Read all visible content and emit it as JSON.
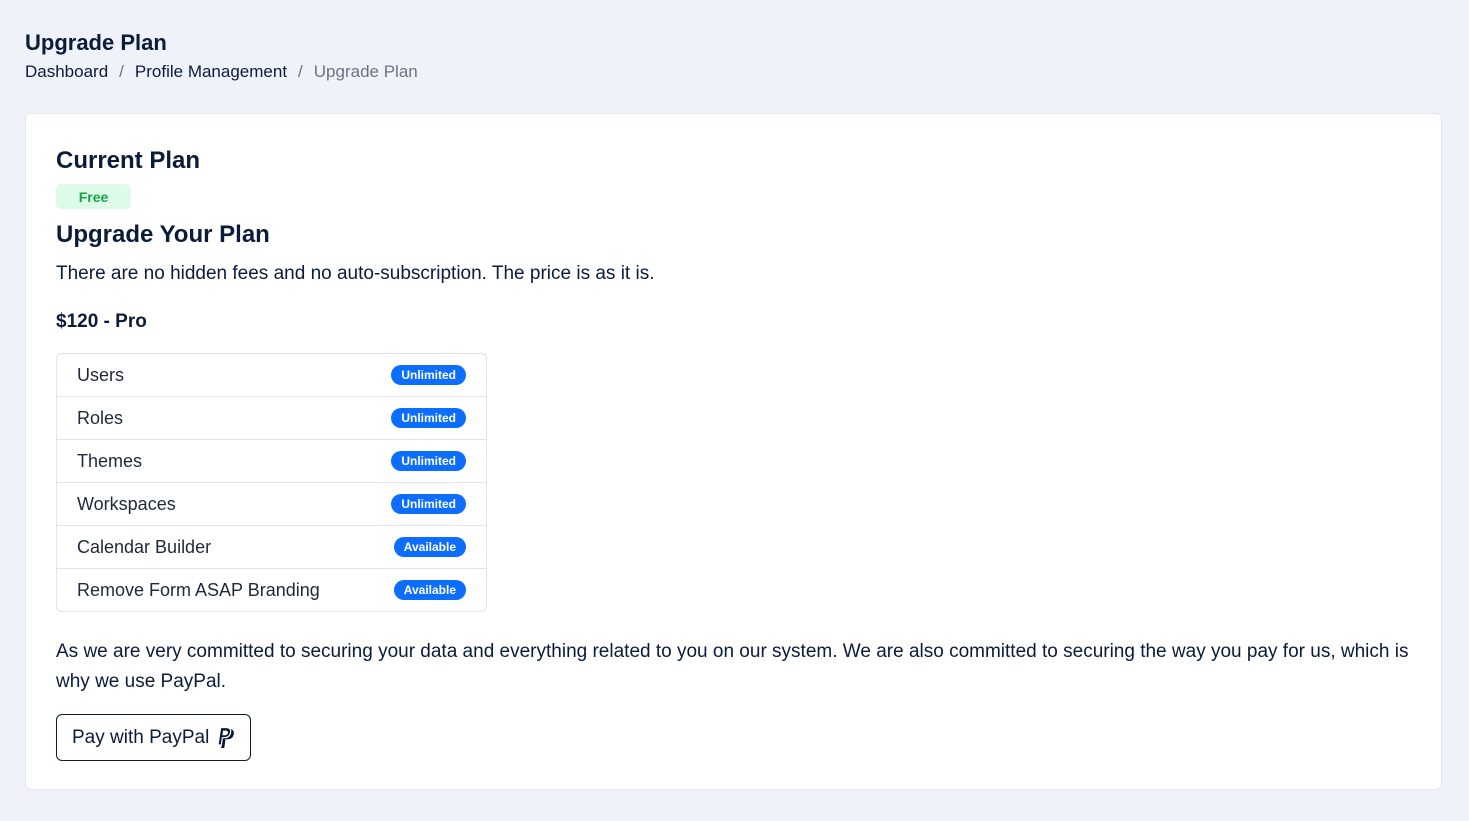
{
  "header": {
    "title": "Upgrade Plan",
    "breadcrumb": [
      {
        "label": "Dashboard"
      },
      {
        "label": "Profile Management"
      },
      {
        "label": "Upgrade Plan"
      }
    ],
    "separator": "/"
  },
  "current_plan": {
    "heading": "Current Plan",
    "badge": "Free"
  },
  "upgrade": {
    "heading": "Upgrade Your Plan",
    "description": "There are no hidden fees and no auto-subscription. The price is as it is.",
    "price_label": "$120 - Pro",
    "features": [
      {
        "name": "Users",
        "value": "Unlimited"
      },
      {
        "name": "Roles",
        "value": "Unlimited"
      },
      {
        "name": "Themes",
        "value": "Unlimited"
      },
      {
        "name": "Workspaces",
        "value": "Unlimited"
      },
      {
        "name": "Calendar Builder",
        "value": "Available"
      },
      {
        "name": "Remove Form ASAP Branding",
        "value": "Available"
      }
    ],
    "security_note": "As we are very committed to securing your data and everything related to you on our system. We are also committed to securing the way you pay for us, which is why we use PayPal.",
    "pay_button_label": "Pay with PayPal",
    "pay_button_icon": "paypal-icon"
  },
  "colors": {
    "page_background": "#eff2f9",
    "text_primary": "#0c1b3a",
    "free_badge_bg": "#dcfce7",
    "free_badge_text": "#16a34a",
    "feature_badge_bg": "#0d6efd"
  }
}
